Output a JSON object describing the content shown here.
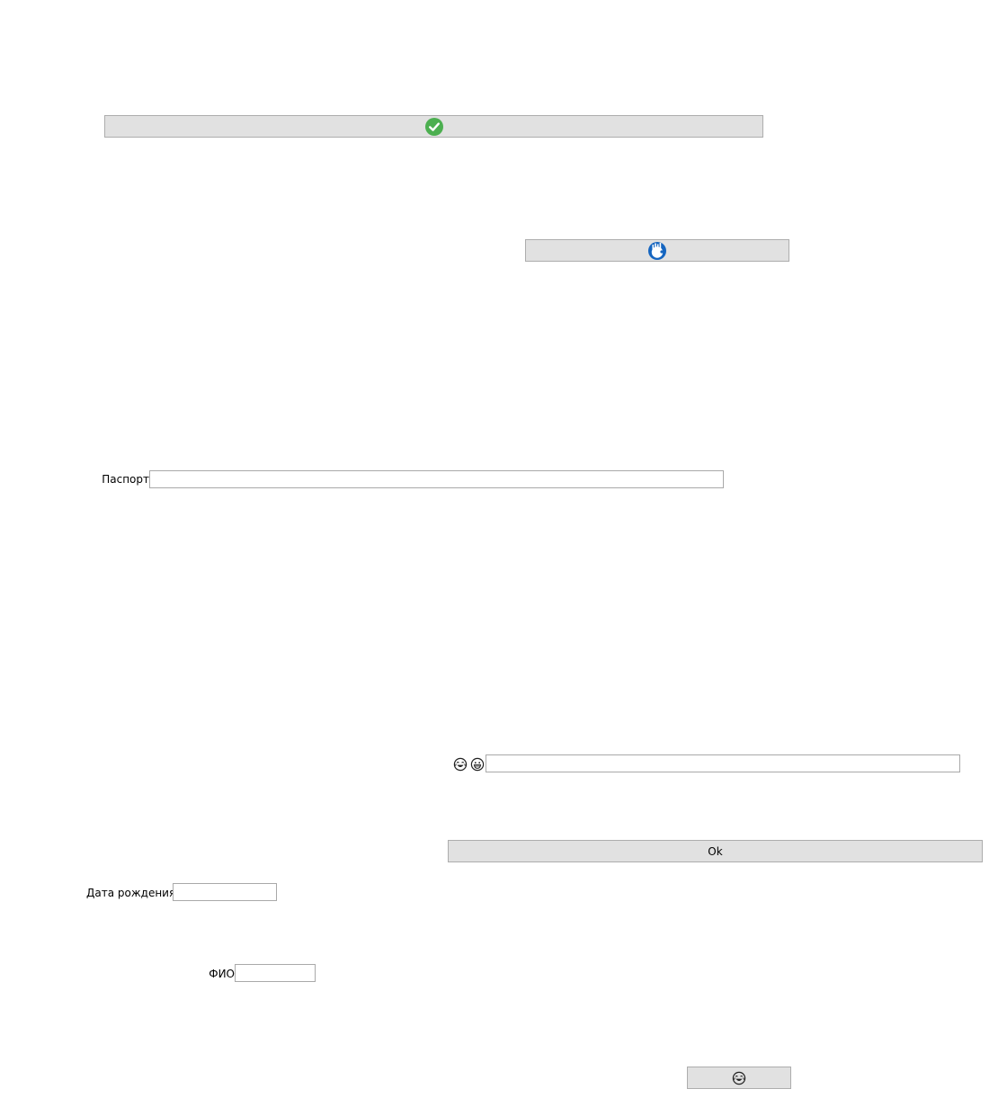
{
  "buttons": {
    "confirm": {
      "icon": "check-circle-icon"
    },
    "crowd": {
      "icon": "crowd-circle-icon"
    },
    "ok": {
      "label": "Ok"
    },
    "emoji": {
      "icon": "laughing-face-icon"
    }
  },
  "form": {
    "passport_label": "Паспорт",
    "passport_value": "",
    "birthdate_label": "Дата рождения",
    "birthdate_value": "",
    "fio_label": "ФИО",
    "fio_value": "",
    "emoji_field_value": "",
    "emoji_field_icons": [
      "laughing-face-icon",
      "grinning-face-icon"
    ]
  },
  "colors": {
    "check_green": "#4caf50",
    "crowd_blue": "#1565c0",
    "button_bg": "#e1e1e1",
    "button_border": "#adadad",
    "field_border": "#a9a9a9"
  }
}
